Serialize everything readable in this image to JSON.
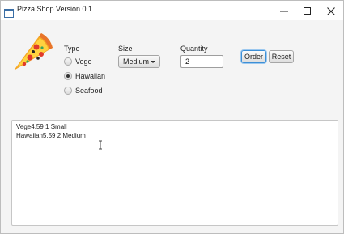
{
  "window": {
    "title": "Pizza Shop Version 0.1",
    "controls": [
      "minimize-icon",
      "maximize-icon",
      "close-icon"
    ]
  },
  "type": {
    "label": "Type",
    "options": [
      {
        "label": "Vege",
        "selected": false
      },
      {
        "label": "Hawaiian",
        "selected": true
      },
      {
        "label": "Seafood",
        "selected": false
      }
    ]
  },
  "size": {
    "label": "Size",
    "selected": "Medium"
  },
  "quantity": {
    "label": "Quantity",
    "value": "2"
  },
  "buttons": {
    "order": "Order",
    "reset": "Reset"
  },
  "output": {
    "lines": [
      "Vege4.59 1 Small",
      "Hawaiian5.59 2 Medium"
    ]
  },
  "icons": {
    "app": "app-window-icon",
    "logo": "pizza-slice-icon",
    "cursor": "text-cursor-icon"
  },
  "colors": {
    "focus": "#3d8fd6"
  }
}
